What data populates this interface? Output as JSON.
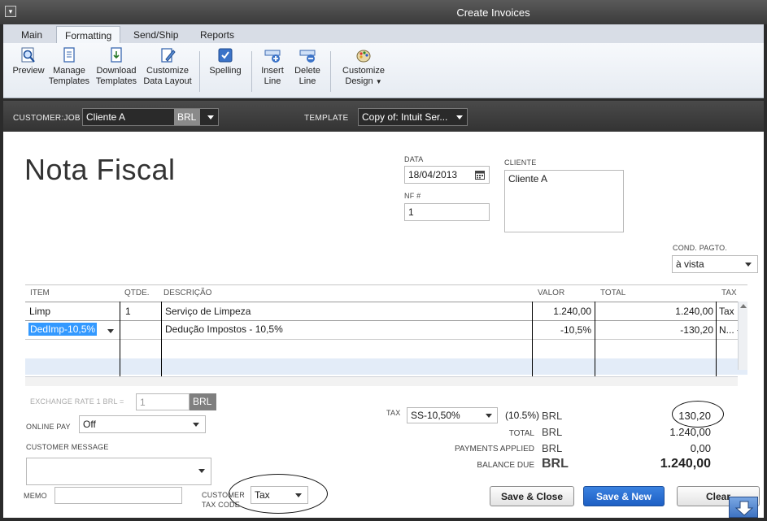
{
  "window": {
    "title": "Create Invoices",
    "sys_icon": "▾"
  },
  "ribbon_tabs": [
    "Main",
    "Formatting",
    "Send/Ship",
    "Reports"
  ],
  "ribbon_buttons": {
    "preview": "Preview",
    "manage_templates_1": "Manage",
    "manage_templates_2": "Templates",
    "download_templates_1": "Download",
    "download_templates_2": "Templates",
    "customize_layout_1": "Customize",
    "customize_layout_2": "Data Layout",
    "spelling": "Spelling",
    "insert_line_1": "Insert",
    "insert_line_2": "Line",
    "delete_line_1": "Delete",
    "delete_line_2": "Line",
    "customize_design_1": "Customize",
    "customize_design_2": "Design"
  },
  "customer_bar": {
    "customer_label": "CUSTOMER:JOB",
    "customer_value": "Cliente A",
    "currency": "BRL",
    "template_label": "TEMPLATE",
    "template_value": "Copy of: Intuit Ser..."
  },
  "form": {
    "title": "Nota Fiscal",
    "data_label": "DATA",
    "data_value": "18/04/2013",
    "nf_label": "NF #",
    "nf_value": "1",
    "cliente_label": "CLIENTE",
    "cliente_value": "Cliente A",
    "cond_label": "COND. PAGTO.",
    "cond_value": "à vista"
  },
  "grid": {
    "headers": [
      "ITEM",
      "QTDE.",
      "DESCRIÇÃO",
      "VALOR",
      "TOTAL",
      "TAX"
    ],
    "rows": [
      {
        "item": "Limp",
        "qty": "1",
        "desc": "Serviço de Limpeza",
        "valor": "1.240,00",
        "total": "1.240,00",
        "tax": "Tax"
      },
      {
        "item": "DedImp-10,5%",
        "qty": "",
        "desc": "Dedução Impostos - 10,5%",
        "valor": "-10,5%",
        "total": "-130,20",
        "tax": "N..."
      }
    ]
  },
  "lower": {
    "exchange_label": "EXCHANGE RATE 1 BRL =",
    "exchange_value": "1",
    "exchange_currency": "BRL",
    "online_pay_label": "ONLINE PAY",
    "online_pay_value": "Off",
    "customer_message_label": "CUSTOMER MESSAGE",
    "memo_label": "MEMO",
    "customer_tax_label_1": "CUSTOMER",
    "customer_tax_label_2": "TAX CODE",
    "customer_tax_value": "Tax"
  },
  "summary": {
    "tax_label": "TAX",
    "tax_item": "SS-10,50%",
    "tax_rate": "(10.5%)",
    "tax_currency": "BRL",
    "tax_amount": "130,20",
    "total_label": "TOTAL",
    "total_currency": "BRL",
    "total_amount": "1.240,00",
    "payments_label": "PAYMENTS APPLIED",
    "payments_currency": "BRL",
    "payments_amount": "0,00",
    "balance_label": "BALANCE DUE",
    "balance_currency": "BRL",
    "balance_amount": "1.240,00"
  },
  "buttons": {
    "save_close": "Save & Close",
    "save_new": "Save & New",
    "clear": "Clear"
  },
  "colors": {
    "accent": "#1d5fc4",
    "selection": "#3399ff",
    "stripe": "#e3ecf8"
  }
}
